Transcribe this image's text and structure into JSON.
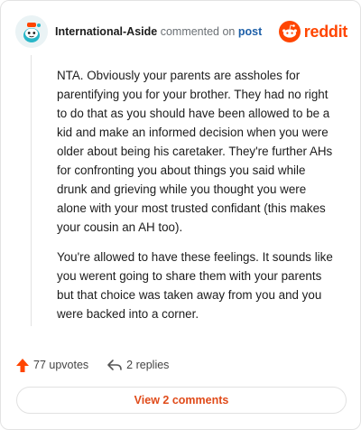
{
  "header": {
    "username": "International-Aside",
    "action_text": "commented on",
    "post_link": "post",
    "brand": "reddit"
  },
  "comment": {
    "paragraphs": [
      "NTA. Obviously your parents are assholes for parentifying you for your brother. They had no right to do that as you should have been allowed to be a kid and make an informed decision when you were older about being his caretaker. They're further AHs for confronting you about things you said while drunk and grieving while you thought you were alone with your most trusted confidant (this makes your cousin an AH too).",
      "You're allowed to have these feelings. It sounds like you werent going to share them with your parents but that choice was taken away from you and you were backed into a corner."
    ]
  },
  "actions": {
    "upvotes": "77 upvotes",
    "replies": "2 replies"
  },
  "footer": {
    "view_comments": "View 2 comments"
  },
  "colors": {
    "brand": "#ff4500",
    "link": "#1d5fa8",
    "button_text": "#e04b1a"
  },
  "icons": {
    "avatar": "snoo-avatar",
    "brand": "reddit-logo-icon",
    "upvote": "upvote-arrow-icon",
    "reply": "reply-arrow-icon"
  }
}
